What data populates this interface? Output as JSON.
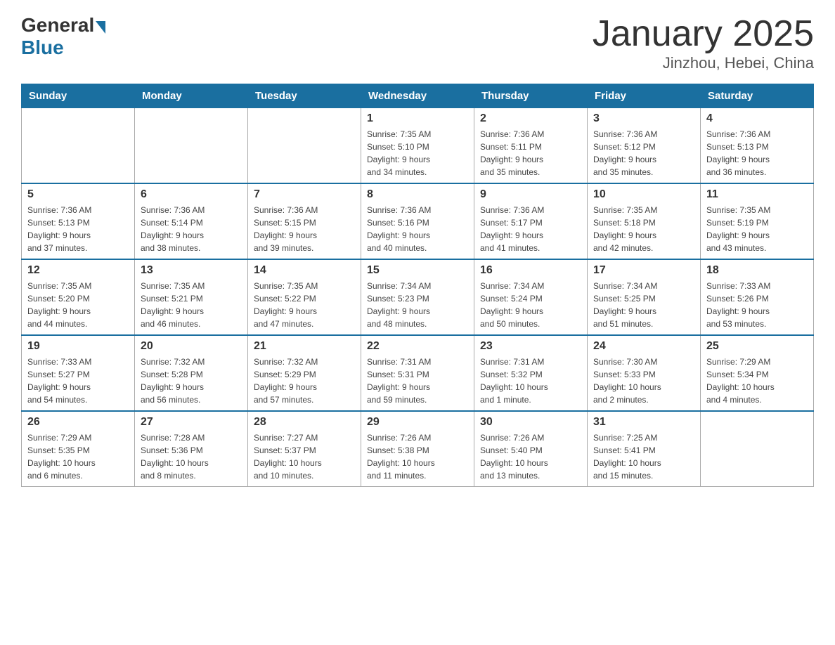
{
  "header": {
    "logo_general": "General",
    "logo_blue": "Blue",
    "month_title": "January 2025",
    "location": "Jinzhou, Hebei, China"
  },
  "days_of_week": [
    "Sunday",
    "Monday",
    "Tuesday",
    "Wednesday",
    "Thursday",
    "Friday",
    "Saturday"
  ],
  "weeks": [
    [
      {
        "day": "",
        "info": ""
      },
      {
        "day": "",
        "info": ""
      },
      {
        "day": "",
        "info": ""
      },
      {
        "day": "1",
        "info": "Sunrise: 7:35 AM\nSunset: 5:10 PM\nDaylight: 9 hours\nand 34 minutes."
      },
      {
        "day": "2",
        "info": "Sunrise: 7:36 AM\nSunset: 5:11 PM\nDaylight: 9 hours\nand 35 minutes."
      },
      {
        "day": "3",
        "info": "Sunrise: 7:36 AM\nSunset: 5:12 PM\nDaylight: 9 hours\nand 35 minutes."
      },
      {
        "day": "4",
        "info": "Sunrise: 7:36 AM\nSunset: 5:13 PM\nDaylight: 9 hours\nand 36 minutes."
      }
    ],
    [
      {
        "day": "5",
        "info": "Sunrise: 7:36 AM\nSunset: 5:13 PM\nDaylight: 9 hours\nand 37 minutes."
      },
      {
        "day": "6",
        "info": "Sunrise: 7:36 AM\nSunset: 5:14 PM\nDaylight: 9 hours\nand 38 minutes."
      },
      {
        "day": "7",
        "info": "Sunrise: 7:36 AM\nSunset: 5:15 PM\nDaylight: 9 hours\nand 39 minutes."
      },
      {
        "day": "8",
        "info": "Sunrise: 7:36 AM\nSunset: 5:16 PM\nDaylight: 9 hours\nand 40 minutes."
      },
      {
        "day": "9",
        "info": "Sunrise: 7:36 AM\nSunset: 5:17 PM\nDaylight: 9 hours\nand 41 minutes."
      },
      {
        "day": "10",
        "info": "Sunrise: 7:35 AM\nSunset: 5:18 PM\nDaylight: 9 hours\nand 42 minutes."
      },
      {
        "day": "11",
        "info": "Sunrise: 7:35 AM\nSunset: 5:19 PM\nDaylight: 9 hours\nand 43 minutes."
      }
    ],
    [
      {
        "day": "12",
        "info": "Sunrise: 7:35 AM\nSunset: 5:20 PM\nDaylight: 9 hours\nand 44 minutes."
      },
      {
        "day": "13",
        "info": "Sunrise: 7:35 AM\nSunset: 5:21 PM\nDaylight: 9 hours\nand 46 minutes."
      },
      {
        "day": "14",
        "info": "Sunrise: 7:35 AM\nSunset: 5:22 PM\nDaylight: 9 hours\nand 47 minutes."
      },
      {
        "day": "15",
        "info": "Sunrise: 7:34 AM\nSunset: 5:23 PM\nDaylight: 9 hours\nand 48 minutes."
      },
      {
        "day": "16",
        "info": "Sunrise: 7:34 AM\nSunset: 5:24 PM\nDaylight: 9 hours\nand 50 minutes."
      },
      {
        "day": "17",
        "info": "Sunrise: 7:34 AM\nSunset: 5:25 PM\nDaylight: 9 hours\nand 51 minutes."
      },
      {
        "day": "18",
        "info": "Sunrise: 7:33 AM\nSunset: 5:26 PM\nDaylight: 9 hours\nand 53 minutes."
      }
    ],
    [
      {
        "day": "19",
        "info": "Sunrise: 7:33 AM\nSunset: 5:27 PM\nDaylight: 9 hours\nand 54 minutes."
      },
      {
        "day": "20",
        "info": "Sunrise: 7:32 AM\nSunset: 5:28 PM\nDaylight: 9 hours\nand 56 minutes."
      },
      {
        "day": "21",
        "info": "Sunrise: 7:32 AM\nSunset: 5:29 PM\nDaylight: 9 hours\nand 57 minutes."
      },
      {
        "day": "22",
        "info": "Sunrise: 7:31 AM\nSunset: 5:31 PM\nDaylight: 9 hours\nand 59 minutes."
      },
      {
        "day": "23",
        "info": "Sunrise: 7:31 AM\nSunset: 5:32 PM\nDaylight: 10 hours\nand 1 minute."
      },
      {
        "day": "24",
        "info": "Sunrise: 7:30 AM\nSunset: 5:33 PM\nDaylight: 10 hours\nand 2 minutes."
      },
      {
        "day": "25",
        "info": "Sunrise: 7:29 AM\nSunset: 5:34 PM\nDaylight: 10 hours\nand 4 minutes."
      }
    ],
    [
      {
        "day": "26",
        "info": "Sunrise: 7:29 AM\nSunset: 5:35 PM\nDaylight: 10 hours\nand 6 minutes."
      },
      {
        "day": "27",
        "info": "Sunrise: 7:28 AM\nSunset: 5:36 PM\nDaylight: 10 hours\nand 8 minutes."
      },
      {
        "day": "28",
        "info": "Sunrise: 7:27 AM\nSunset: 5:37 PM\nDaylight: 10 hours\nand 10 minutes."
      },
      {
        "day": "29",
        "info": "Sunrise: 7:26 AM\nSunset: 5:38 PM\nDaylight: 10 hours\nand 11 minutes."
      },
      {
        "day": "30",
        "info": "Sunrise: 7:26 AM\nSunset: 5:40 PM\nDaylight: 10 hours\nand 13 minutes."
      },
      {
        "day": "31",
        "info": "Sunrise: 7:25 AM\nSunset: 5:41 PM\nDaylight: 10 hours\nand 15 minutes."
      },
      {
        "day": "",
        "info": ""
      }
    ]
  ]
}
